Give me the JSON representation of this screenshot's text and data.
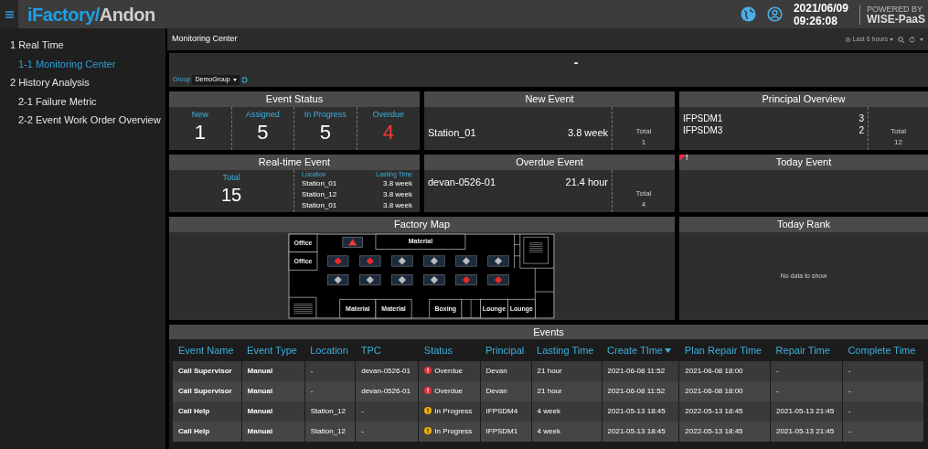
{
  "header": {
    "logo_primary": "iFactory/",
    "logo_secondary": "Andon",
    "date": "2021/06/09",
    "time": "09:26:08",
    "powered_by": "POWERED BY",
    "platform": "WISE-PaaS"
  },
  "sidebar": {
    "items": [
      {
        "label": "1 Real Time",
        "selected": false,
        "children": [
          {
            "label": "1-1 Monitoring Center",
            "selected": true
          }
        ]
      },
      {
        "label": "2 History Analysis",
        "selected": false,
        "children": [
          {
            "label": "2-1 Failure Metric",
            "selected": false
          },
          {
            "label": "2-2 Event Work Order Overview",
            "selected": false
          }
        ]
      }
    ]
  },
  "dashboard": {
    "title": "Monitoring Center",
    "time_range": "Last 6 hours",
    "banner_title": "-",
    "group_label": "Group",
    "group_value": "DemoGroup"
  },
  "event_status": {
    "title": "Event Status",
    "stats": [
      {
        "label": "New",
        "value": "1",
        "alert": false
      },
      {
        "label": "Assigned",
        "value": "5",
        "alert": false
      },
      {
        "label": "In Progress",
        "value": "5",
        "alert": false
      },
      {
        "label": "Overdue",
        "value": "4",
        "alert": true
      }
    ]
  },
  "new_event": {
    "title": "New Event",
    "rows": [
      {
        "name": "Station_01",
        "duration": "3.8 week"
      }
    ],
    "total_label": "Total",
    "total": "1"
  },
  "principal_overview": {
    "title": "Principal Overview",
    "rows": [
      {
        "name": "IFPSDM1",
        "count": "3"
      },
      {
        "name": "IFPSDM3",
        "count": "2"
      }
    ],
    "total_label": "Total",
    "total": "12"
  },
  "realtime_event": {
    "title": "Real-time Event",
    "total_label": "Total",
    "total": "15",
    "columns": [
      "Location",
      "Lasting Time"
    ],
    "rows": [
      {
        "location": "Station_01",
        "duration": "3.8 week"
      },
      {
        "location": "Station_12",
        "duration": "3.8 week"
      },
      {
        "location": "Station_01",
        "duration": "3.8 week"
      }
    ]
  },
  "overdue_event": {
    "title": "Overdue Event",
    "rows": [
      {
        "name": "devan-0526-01",
        "duration": "21.4 hour"
      }
    ],
    "total_label": "Total",
    "total": "4"
  },
  "today_event": {
    "title": "Today Event",
    "flagged": true
  },
  "factory_map": {
    "title": "Factory Map",
    "rooms": [
      {
        "label": "Office",
        "kind": "office"
      },
      {
        "label": "Office",
        "kind": "office"
      },
      {
        "label": "Material",
        "kind": "material_top"
      },
      {
        "label": "Material",
        "kind": "material_a"
      },
      {
        "label": "Material",
        "kind": "material_b"
      },
      {
        "label": "Boxing",
        "kind": "boxing"
      },
      {
        "label": "Lounge",
        "kind": "lounge_a"
      },
      {
        "label": "Lounge",
        "kind": "lounge_b"
      }
    ],
    "stations": [
      {
        "alert": true
      },
      {
        "alert": true
      },
      {
        "alert": false
      },
      {
        "alert": false
      },
      {
        "alert": false
      },
      {
        "alert": false
      },
      {
        "alert": false
      },
      {
        "alert": false
      },
      {
        "alert": false
      },
      {
        "alert": false
      },
      {
        "alert": true
      },
      {
        "alert": true
      }
    ]
  },
  "today_rank": {
    "title": "Today Rank",
    "empty_text": "No data to show"
  },
  "events_table": {
    "title": "Events",
    "columns": [
      {
        "label": "Event Name",
        "sorted": false
      },
      {
        "label": "Event Type",
        "sorted": false
      },
      {
        "label": "Location",
        "sorted": false
      },
      {
        "label": "TPC",
        "sorted": false
      },
      {
        "label": "Status",
        "sorted": false
      },
      {
        "label": "Principal",
        "sorted": false
      },
      {
        "label": "Lasting Time",
        "sorted": false
      },
      {
        "label": "Create TIme",
        "sorted": true
      },
      {
        "label": "Plan Repair Time",
        "sorted": false
      },
      {
        "label": "Repair Time",
        "sorted": false
      },
      {
        "label": "Complete Time",
        "sorted": false
      }
    ],
    "rows": [
      {
        "cells": [
          "Call Supervisor",
          "Manual",
          "-",
          "devan-0526-01",
          "Overdue",
          "Devan",
          "21 hour",
          "2021-06-08 11:52",
          "2021-06-08 18:00",
          "-",
          "-"
        ],
        "kind": "overdue"
      },
      {
        "cells": [
          "Call Supervisor",
          "Manual",
          "-",
          "devan-0526-01",
          "Overdue",
          "Devan",
          "21 hour",
          "2021-06-08 11:52",
          "2021-06-08 18:00",
          "-",
          "-"
        ],
        "kind": "overdue"
      },
      {
        "cells": [
          "Call Help",
          "Manual",
          "Station_12",
          "-",
          "In Progress",
          "IFPSDM4",
          "4 week",
          "2021-05-13 18:45",
          "2022-05-13 18:45",
          "2021-05-13 21:45",
          "-"
        ],
        "kind": "in_progress"
      },
      {
        "cells": [
          "Call Help",
          "Manual",
          "Station_12",
          "-",
          "In Progress",
          "IFPSDM1",
          "4 week",
          "2021-05-13 18:45",
          "2022-05-13 18:45",
          "2021-05-13 21:45",
          "-"
        ],
        "kind": "in_progress"
      }
    ]
  }
}
